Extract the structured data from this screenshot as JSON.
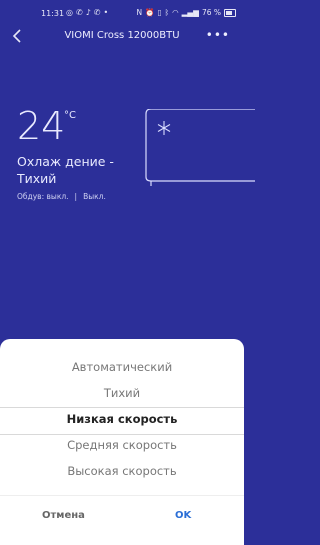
{
  "status": {
    "time": "11:31",
    "left_icons": [
      "whatsapp-icon",
      "phone-icon",
      "bell-icon",
      "viber-icon",
      "dot-icon"
    ],
    "right_text": "76 %"
  },
  "header": {
    "title": "VIOMI Cross 12000BTU"
  },
  "device": {
    "temperature": "24",
    "unit": "°C",
    "mode": "Охлаж дение - Тихий",
    "blow_label": "Обдув: выкл.",
    "separator": "|",
    "blow_state": "Выкл."
  },
  "picker": {
    "options": [
      "Автоматический",
      "Тихий",
      "Низкая скорость",
      "Средняя скорость",
      "Высокая скорость"
    ],
    "selected_index": 2,
    "cancel_label": "Отмена",
    "ok_label": "OK"
  },
  "colors": {
    "background": "#2c2f99",
    "ok_accent": "#2a6ed6"
  }
}
